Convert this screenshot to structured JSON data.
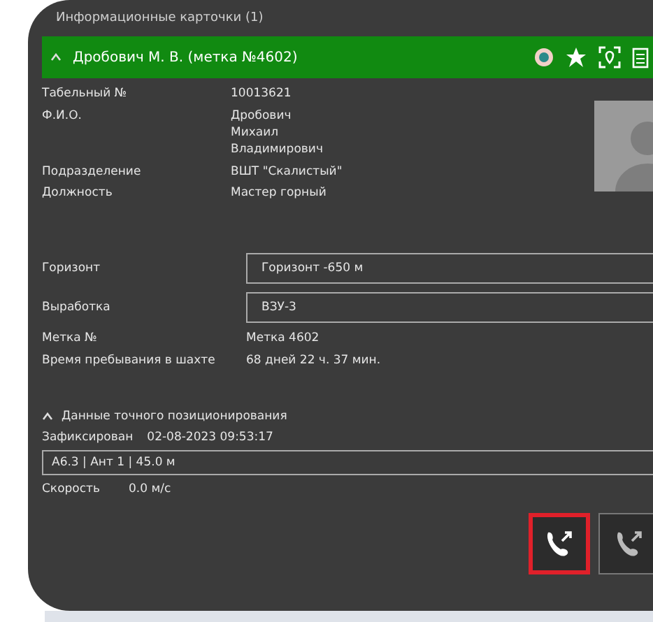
{
  "panel": {
    "title": "Информационные карточки (1)"
  },
  "card": {
    "title": "Дробович М. В. (метка №4602)",
    "expanded": true,
    "color": "#118a11",
    "fields": [
      {
        "label": "Табельный №",
        "value": [
          "10013621"
        ]
      },
      {
        "label": "Ф.И.О.",
        "value": [
          "Дробович",
          "Михаил",
          "Владимирович"
        ]
      },
      {
        "label": "Подразделение",
        "value": [
          "ВШТ \"Скалистый\""
        ]
      },
      {
        "label": "Должность",
        "value": [
          "Мастер горный"
        ]
      }
    ],
    "location": [
      {
        "label": "Горизонт",
        "kind": "box",
        "value": "Горизонт -650 м"
      },
      {
        "label": "Выработка",
        "kind": "box",
        "value": "ВЗУ-3"
      },
      {
        "label": "Метка №",
        "kind": "text",
        "value": "Метка 4602"
      },
      {
        "label": "Время пребывания в шахте",
        "kind": "text",
        "value": "68 дней 22 ч. 37 мин."
      }
    ],
    "positioning": {
      "title": "Данные точного позиционирования",
      "expanded": true,
      "fixed_label": "Зафиксирован",
      "fixed_value": "02-08-2023 09:53:17",
      "position": "А6.3 | Ант 1 | 45.0 м",
      "speed_label": "Скорость",
      "speed_value": "0.0 м/с"
    },
    "buttons": [
      {
        "kind": "call",
        "selected": true
      },
      {
        "kind": "call-out",
        "selected": false
      }
    ]
  }
}
